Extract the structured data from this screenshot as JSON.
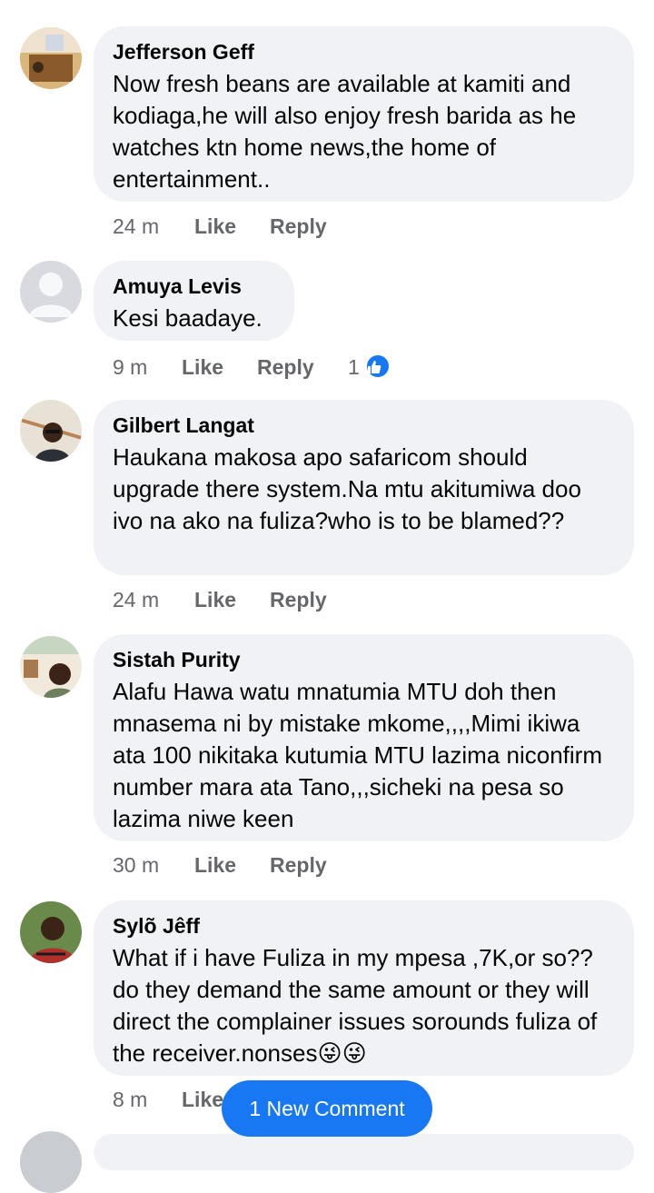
{
  "comments": [
    {
      "author": "Jefferson Geff",
      "text": "Now fresh beans  are available at kamiti and kodiaga,he will also enjoy fresh barida as he watches ktn home news,the home of entertainment..",
      "time": "24 m",
      "like_label": "Like",
      "reply_label": "Reply"
    },
    {
      "author": "Amuya Levis",
      "text": "Kesi baadaye.",
      "time": "9 m",
      "like_label": "Like",
      "reply_label": "Reply",
      "reaction_count": "1"
    },
    {
      "author": "Gilbert Langat",
      "text": "Haukana makosa apo safaricom should upgrade there system.Na mtu akitumiwa doo ivo na ako na fuliza?who is to be blamed??",
      "time": "24 m",
      "like_label": "Like",
      "reply_label": "Reply"
    },
    {
      "author": "Sistah Purity",
      "text": "Alafu Hawa watu mnatumia MTU doh then mnasema ni by mistake mkome,,,,Mimi ikiwa ata 100 nikitaka kutumia MTU lazima niconfirm number mara ata Tano,,,sicheki na pesa so lazima niwe keen",
      "time": "30 m",
      "like_label": "Like",
      "reply_label": "Reply"
    },
    {
      "author": "Sylõ Jêff",
      "text": "What if i have Fuliza in my mpesa ,7K,or so?? do they demand the same amount or they will direct the complainer issues sorounds fuliza of the receiver.nonses😜😜",
      "time": "8 m",
      "like_label": "Like"
    }
  ],
  "new_comment_label": "1 New Comment",
  "colors": {
    "accent": "#1877f2",
    "bubble": "#f0f2f5",
    "meta": "#65676b"
  }
}
